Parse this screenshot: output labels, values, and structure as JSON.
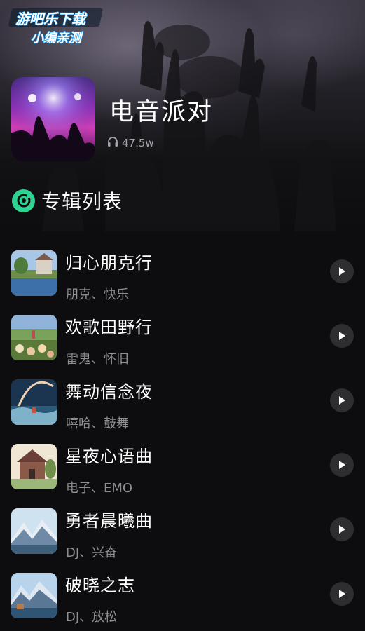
{
  "watermark": {
    "line1": "游吧乐下载",
    "line2": "小编亲测"
  },
  "album": {
    "title": "电音派对",
    "plays": "47.5w",
    "plays_icon": "headphones-icon"
  },
  "section": {
    "title": "专辑列表",
    "icon": "disc-icon",
    "accent": "#2fd391"
  },
  "songs": [
    {
      "title": "归心朋克行",
      "tags": "朋克、快乐"
    },
    {
      "title": "欢歌田野行",
      "tags": "雷鬼、怀旧"
    },
    {
      "title": "舞动信念夜",
      "tags": "嘻哈、鼓舞"
    },
    {
      "title": "星夜心语曲",
      "tags": "电子、EMO"
    },
    {
      "title": "勇者晨曦曲",
      "tags": "DJ、兴奋"
    },
    {
      "title": "破晓之志",
      "tags": "DJ、放松"
    }
  ],
  "play_icon": "play-icon"
}
